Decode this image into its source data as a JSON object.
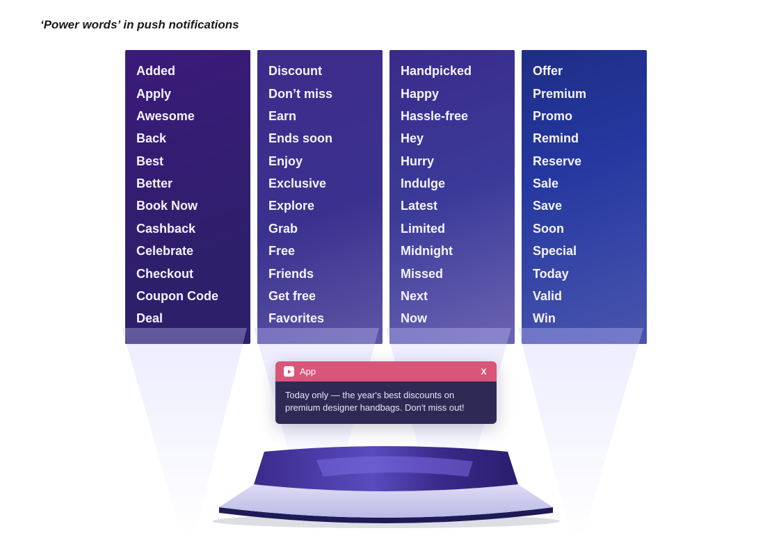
{
  "title": "‘Power words’ in push notifications",
  "columns": [
    [
      "Added",
      "Apply",
      "Awesome",
      "Back",
      "Best",
      "Better",
      "Book Now",
      "Cashback",
      "Celebrate",
      "Checkout",
      "Coupon Code",
      "Deal"
    ],
    [
      "Discount",
      "Don’t miss",
      "Earn",
      "Ends soon",
      "Enjoy",
      "Exclusive",
      "Explore",
      "Grab",
      "Free",
      "Friends",
      "Get free",
      "Favorites"
    ],
    [
      "Handpicked",
      "Happy",
      "Hassle-free",
      "Hey",
      "Hurry",
      "Indulge",
      "Latest",
      "Limited",
      "Midnight",
      "Missed",
      "Next",
      "Now"
    ],
    [
      "Offer",
      "Premium",
      "Promo",
      "Remind",
      "Reserve",
      "Sale",
      "Save",
      "Soon",
      "Special",
      "Today",
      "Valid",
      "Win"
    ]
  ],
  "notification": {
    "app_label": "App",
    "close_label": "X",
    "body": "Today only — the year's best discounts on premium designer handbags. Don't miss out!"
  }
}
